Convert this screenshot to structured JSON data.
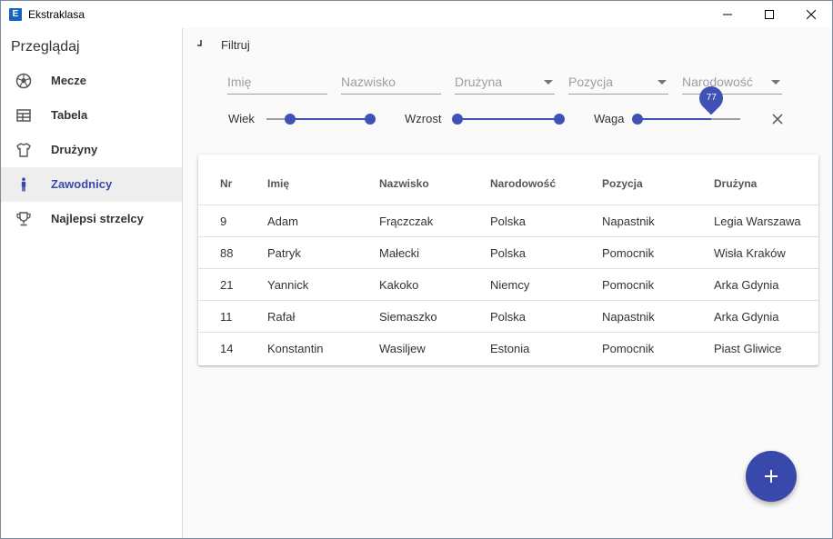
{
  "window": {
    "title": "Ekstraklasa",
    "icon_letter": "E"
  },
  "sidebar": {
    "header": "Przeglądaj",
    "items": [
      {
        "label": "Mecze",
        "icon": "soccer-ball-icon"
      },
      {
        "label": "Tabela",
        "icon": "table-icon"
      },
      {
        "label": "Drużyny",
        "icon": "shirt-icon"
      },
      {
        "label": "Zawodnicy",
        "icon": "person-icon",
        "active": true
      },
      {
        "label": "Najlepsi strzelcy",
        "icon": "trophy-icon"
      }
    ]
  },
  "filter": {
    "label": "Filtruj",
    "fields": {
      "first_name": "Imię",
      "last_name": "Nazwisko",
      "team": "Drużyna",
      "position": "Pozycja",
      "nationality": "Narodowość"
    },
    "sliders": {
      "age": {
        "label": "Wiek",
        "low_fraction": 0.23,
        "high_fraction": 1.0
      },
      "height": {
        "label": "Wzrost",
        "low_fraction": 0.0,
        "high_fraction": 1.0
      },
      "weight": {
        "label": "Waga",
        "value": "77",
        "fraction": 0.72
      }
    }
  },
  "table": {
    "headers": [
      "Nr",
      "Imię",
      "Nazwisko",
      "Narodowość",
      "Pozycja",
      "Drużyna"
    ],
    "rows": [
      [
        "9",
        "Adam",
        "Frączczak",
        "Polska",
        "Napastnik",
        "Legia Warszawa"
      ],
      [
        "88",
        "Patryk",
        "Małecki",
        "Polska",
        "Pomocnik",
        "Wisła Kraków"
      ],
      [
        "21",
        "Yannick",
        "Kakoko",
        "Niemcy",
        "Pomocnik",
        "Arka Gdynia"
      ],
      [
        "11",
        "Rafał",
        "Siemaszko",
        "Polska",
        "Napastnik",
        "Arka Gdynia"
      ],
      [
        "14",
        "Konstantin",
        "Wasiljew",
        "Estonia",
        "Pomocnik",
        "Piast Gliwice"
      ]
    ]
  },
  "colors": {
    "accent": "#3f51b5",
    "fab": "#3949ab"
  }
}
